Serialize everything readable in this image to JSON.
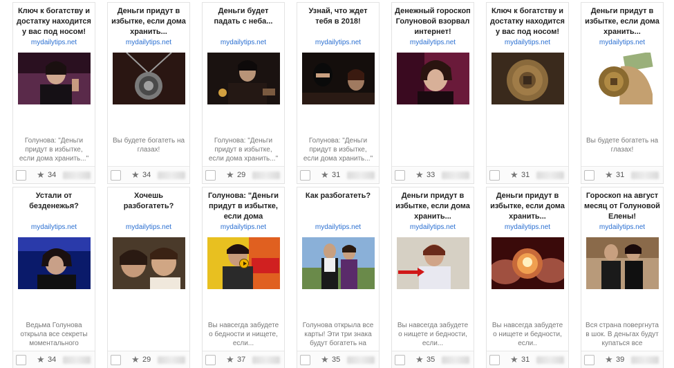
{
  "cards": [
    {
      "title": "Ключ к богатству и достатку находится у вас под носом!",
      "domain": "mydailytips.net",
      "description": "Голунова: \"Деньги придут в избытке, если дома хранить...\"",
      "rating": "34",
      "image_icon": "woman-portrait-image"
    },
    {
      "title": "Деньги придут в избытке, если дома хранить...",
      "domain": "mydailytips.net",
      "description": "Вы будете богатеть на глазах!",
      "rating": "34",
      "image_icon": "pendant-image"
    },
    {
      "title": "Деньги будет падать с неба...",
      "domain": "mydailytips.net",
      "description": "Голунова: \"Деньги придут в избытке, если дома хранить...\"",
      "rating": "29",
      "image_icon": "dark-scene-image"
    },
    {
      "title": "Узнай, что ждет тебя в 2018!",
      "domain": "mydailytips.net",
      "description": "Голунова: \"Деньги придут в избытке, если дома хранить...\"",
      "rating": "31",
      "image_icon": "dark-scene-image"
    },
    {
      "title": "Денежный гороскоп Голуновой взорвал интернет!",
      "domain": "mydailytips.net",
      "description": "",
      "rating": "33",
      "image_icon": "woman-portrait-image"
    },
    {
      "title": "Ключ к богатству и достатку находится у вас под носом!",
      "domain": "mydailytips.net",
      "description": "",
      "rating": "31",
      "image_icon": "coin-image"
    },
    {
      "title": "Деньги придут в избытке, если дома хранить...",
      "domain": "mydailytips.net",
      "description": "Вы будете богатеть на глазах!",
      "rating": "31",
      "image_icon": "money-bag-image"
    },
    {
      "title": "Устали от безденежья?",
      "domain": "mydailytips.net",
      "description": "Ведьма Голунова открыла все секреты моментального богатства!",
      "rating": "34",
      "image_icon": "woman-portrait-image"
    },
    {
      "title": "Хочешь разбогатеть?",
      "domain": "mydailytips.net",
      "description": "",
      "rating": "29",
      "image_icon": "couple-image"
    },
    {
      "title": "Голунова: \"Деньги придут в избытке, если дома хранить...\"",
      "domain": "mydailytips.net",
      "description": "Вы навсегда забудете о бедности и нищете, если...",
      "rating": "37",
      "image_icon": "video-image"
    },
    {
      "title": "Как разбогатеть?",
      "domain": "mydailytips.net",
      "description": "Голунова открыла все карты! Эти три знака будут богатеть на глазах...",
      "rating": "35",
      "image_icon": "couple-image"
    },
    {
      "title": "Деньги придут в избытке, если дома хранить...",
      "domain": "mydailytips.net",
      "description": "Вы навсегда забудете о нищете и бедности, если...",
      "rating": "35",
      "image_icon": "woman-portrait-image"
    },
    {
      "title": "Деньги придут в избытке, если дома хранить...",
      "domain": "mydailytips.net",
      "description": "Вы навсегда забудете о нищете и бедности, если..",
      "rating": "31",
      "image_icon": "crystal-ball-image"
    },
    {
      "title": "Гороскоп на август месяц от Голуновой Елены!",
      "domain": "mydailytips.net",
      "description": "Вся страна повергнута в шок. В деньгах будут купаться все",
      "rating": "39",
      "image_icon": "couple-image"
    }
  ],
  "footer": {
    "star_icon": "star-icon",
    "checkbox_icon": "checkbox"
  }
}
